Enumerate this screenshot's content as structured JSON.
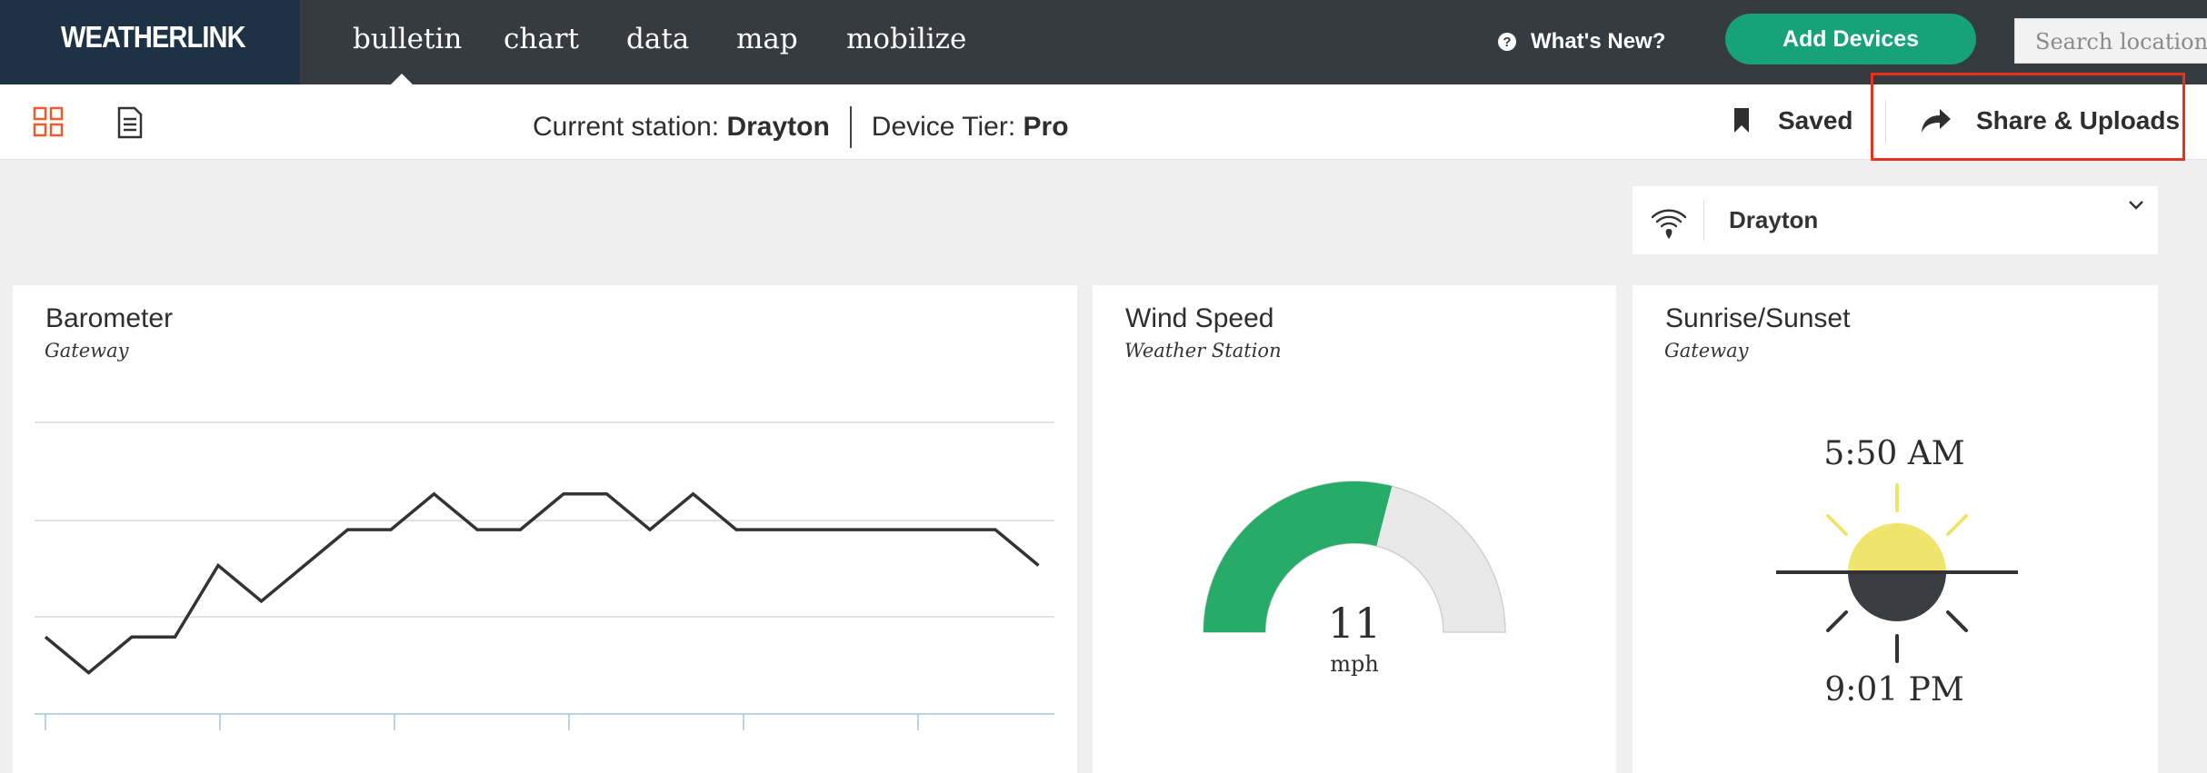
{
  "app": {
    "logo": "WEATHERLINK"
  },
  "nav": {
    "items": [
      {
        "label": "bulletin",
        "active": true
      },
      {
        "label": "chart"
      },
      {
        "label": "data"
      },
      {
        "label": "map"
      },
      {
        "label": "mobilize"
      }
    ],
    "whats_new": "What's New?",
    "add_devices": "Add Devices",
    "search_placeholder": "Search locations"
  },
  "subbar": {
    "station_label": "Current station:",
    "station_name": "Drayton",
    "tier_label": "Device Tier:",
    "tier_value": "Pro",
    "saved": "Saved",
    "share": "Share & Uploads"
  },
  "selector": {
    "station": "Drayton"
  },
  "cards": {
    "barometer": {
      "title": "Barometer",
      "subtitle": "Gateway"
    },
    "wind": {
      "title": "Wind Speed",
      "subtitle": "Weather Station",
      "value": "11",
      "unit": "mph",
      "level": 0.58
    },
    "sun": {
      "title": "Sunrise/Sunset",
      "subtitle": "Gateway",
      "sunrise": "5:50 AM",
      "sunset": "9:01 PM"
    }
  },
  "chart_data": {
    "type": "line",
    "title": "",
    "xlabel": "",
    "ylabel": "",
    "grid": true,
    "series": [
      {
        "values": [
          2,
          1,
          2,
          2,
          4,
          3,
          4,
          5,
          5,
          6,
          5,
          5,
          6,
          6,
          5,
          6,
          5,
          5,
          5,
          5,
          5,
          5,
          5,
          4
        ]
      }
    ],
    "ylim": [
      0,
      8
    ]
  },
  "colors": {
    "topbar": "#363b40",
    "logo_bg": "#1e3246",
    "accent_green": "#17a27a",
    "gauge_fill": "#27ab68",
    "highlight": "#e8321e",
    "sun": "#efe56d"
  }
}
